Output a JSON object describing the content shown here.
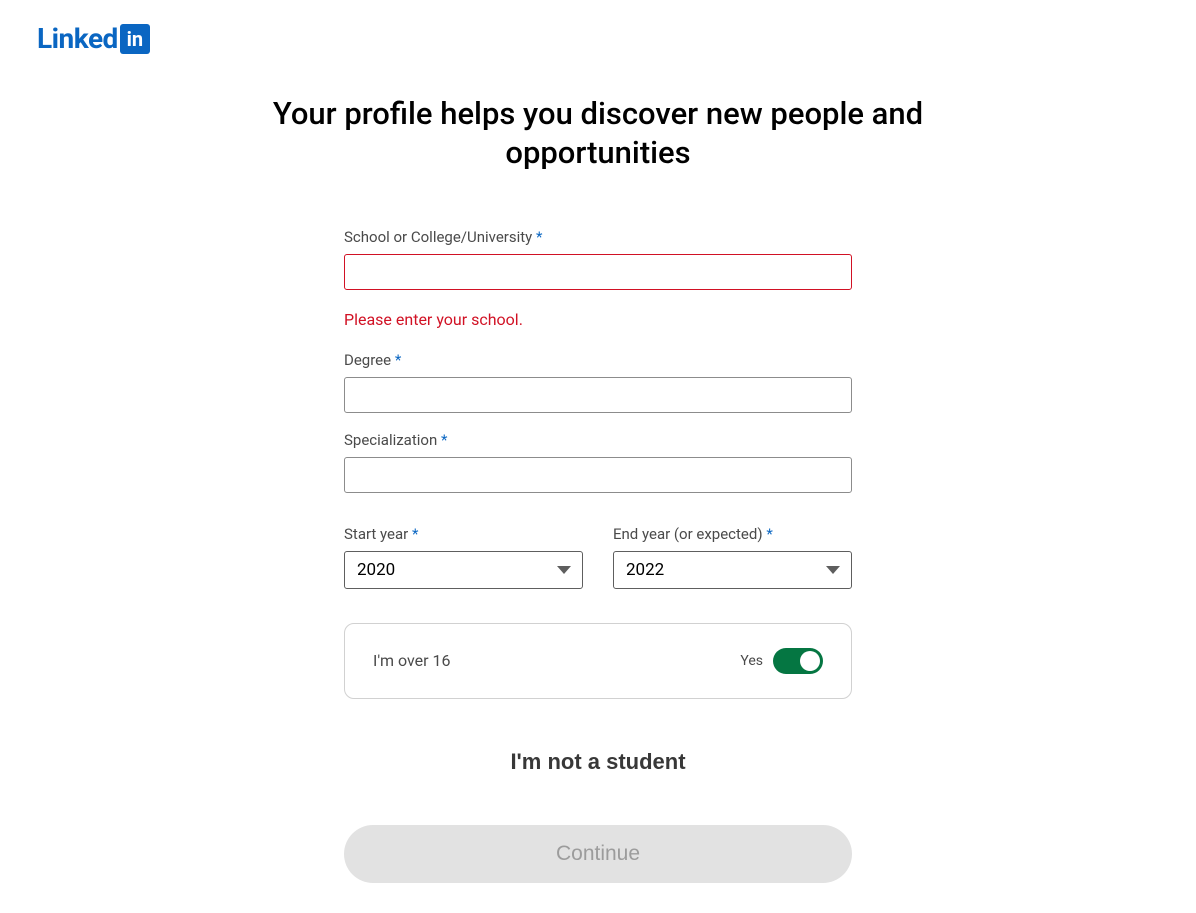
{
  "logo": {
    "text": "Linked",
    "box": "in"
  },
  "headline": "Your profile helps you discover new people and opportunities",
  "form": {
    "school": {
      "label": "School or College/University",
      "value": "",
      "error": "Please enter your school."
    },
    "degree": {
      "label": "Degree",
      "value": ""
    },
    "specialization": {
      "label": "Specialization",
      "value": ""
    },
    "startYear": {
      "label": "Start year",
      "value": "2020"
    },
    "endYear": {
      "label": "End year (or expected)",
      "value": "2022"
    },
    "ageConfirm": {
      "text": "I'm over 16",
      "toggleLabel": "Yes",
      "enabled": true
    }
  },
  "actions": {
    "notStudent": "I'm not a student",
    "continue": "Continue"
  },
  "requiredMark": "*"
}
